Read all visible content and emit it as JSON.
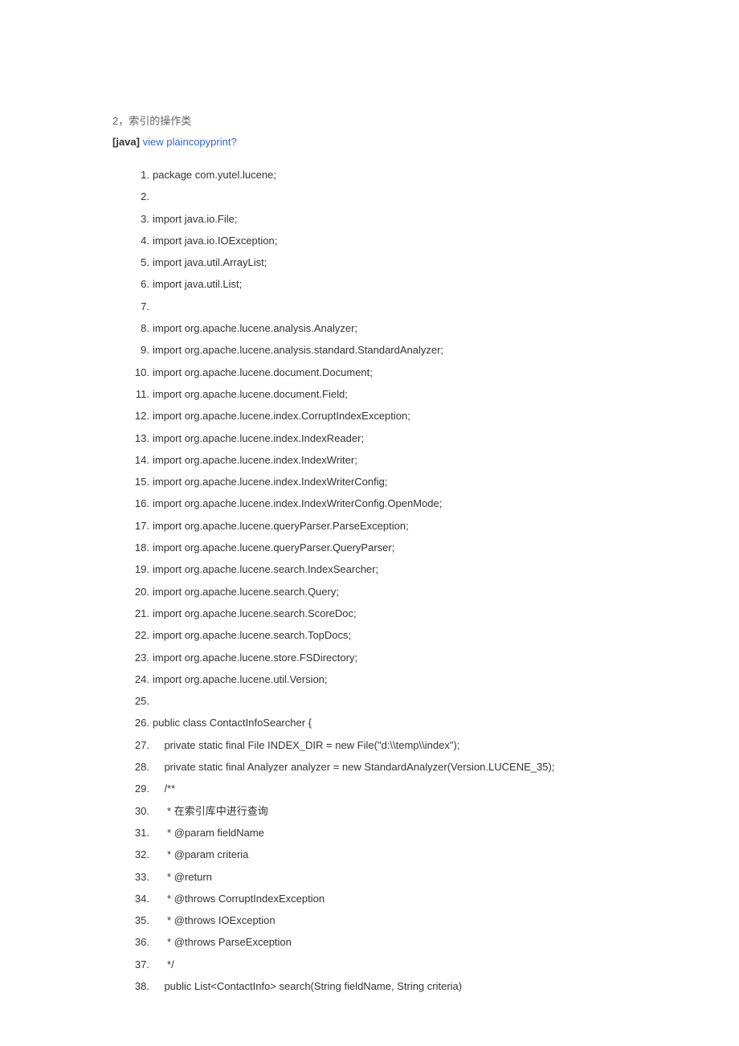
{
  "title": "2，索引的操作类",
  "header": {
    "lang": "[java]",
    "view_plain": "view plain",
    "copy": "copy",
    "print": "print",
    "question": "?"
  },
  "code_lines": [
    "package com.yutel.lucene;  ",
    "  ",
    "import java.io.File;  ",
    "import java.io.IOException;  ",
    "import java.util.ArrayList;  ",
    "import java.util.List;  ",
    "  ",
    "import org.apache.lucene.analysis.Analyzer;  ",
    "import org.apache.lucene.analysis.standard.StandardAnalyzer;  ",
    "import org.apache.lucene.document.Document;  ",
    "import org.apache.lucene.document.Field;  ",
    "import org.apache.lucene.index.CorruptIndexException;  ",
    "import org.apache.lucene.index.IndexReader;  ",
    "import org.apache.lucene.index.IndexWriter;  ",
    "import org.apache.lucene.index.IndexWriterConfig;  ",
    "import org.apache.lucene.index.IndexWriterConfig.OpenMode;  ",
    "import org.apache.lucene.queryParser.ParseException;  ",
    "import org.apache.lucene.queryParser.QueryParser;  ",
    "import org.apache.lucene.search.IndexSearcher;  ",
    "import org.apache.lucene.search.Query;  ",
    "import org.apache.lucene.search.ScoreDoc;  ",
    "import org.apache.lucene.search.TopDocs;  ",
    "import org.apache.lucene.store.FSDirectory;  ",
    "import org.apache.lucene.util.Version;  ",
    "  ",
    "public class ContactInfoSearcher {  ",
    "    private static final File INDEX_DIR = new File(\"d:\\\\temp\\\\index\");  ",
    "    private static final Analyzer analyzer = new StandardAnalyzer(Version.LUCENE_35);  ",
    "    /** ",
    "     * 在索引库中进行查询 ",
    "     * @param fieldName ",
    "     * @param criteria ",
    "     * @return ",
    "     * @throws CorruptIndexException ",
    "     * @throws IOException ",
    "     * @throws ParseException ",
    "     */  ",
    "    public List<ContactInfo> search(String fieldName, String criteria)  "
  ]
}
